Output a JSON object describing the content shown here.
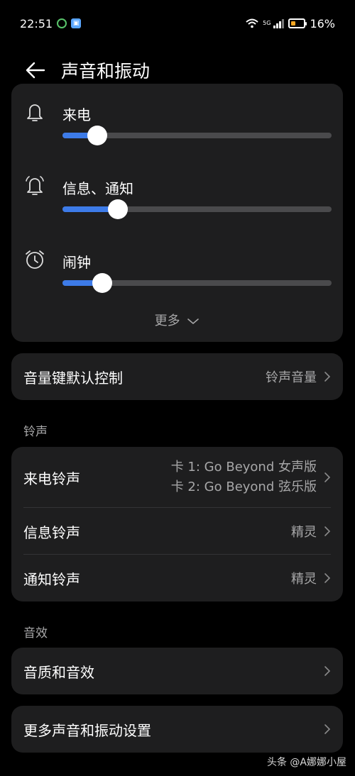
{
  "status_bar": {
    "time": "22:51",
    "network": "5G",
    "battery": "16%"
  },
  "header": {
    "title": "声音和振动"
  },
  "volume": {
    "items": [
      {
        "label": "来电",
        "icon": "bell-icon",
        "level": 0.13
      },
      {
        "label": "信息、通知",
        "icon": "bell-ring-icon",
        "level": 0.205
      },
      {
        "label": "闹钟",
        "icon": "alarm-clock-icon",
        "level": 0.148
      }
    ],
    "more_label": "更多",
    "accent_color": "#3d7be8"
  },
  "volume_key": {
    "label": "音量键默认控制",
    "value": "铃声音量"
  },
  "ringtone_section": {
    "title": "铃声",
    "incoming": {
      "label": "来电铃声",
      "line1": "卡 1: Go Beyond 女声版",
      "line2": "卡 2: Go Beyond 弦乐版"
    },
    "message": {
      "label": "信息铃声",
      "value": "精灵"
    },
    "notification": {
      "label": "通知铃声",
      "value": "精灵"
    }
  },
  "effects_section": {
    "title": "音效",
    "quality": {
      "label": "音质和音效"
    }
  },
  "more_settings": {
    "label": "更多声音和振动设置"
  },
  "watermark": "头条 @A娜娜小屋"
}
